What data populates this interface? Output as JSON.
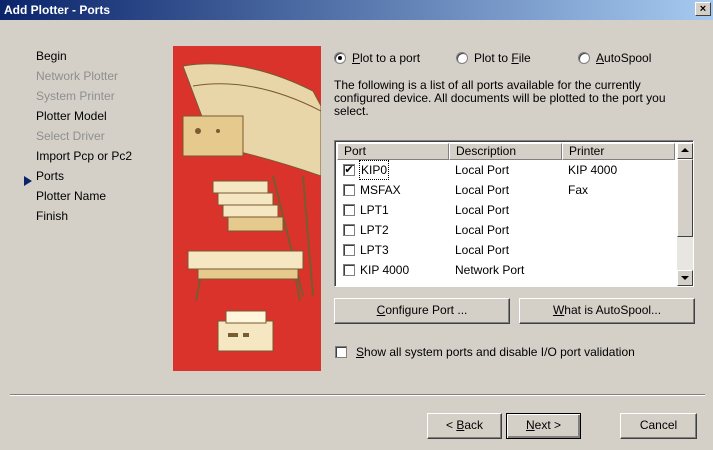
{
  "window": {
    "title": "Add Plotter - Ports",
    "close_glyph": "×"
  },
  "steps": [
    {
      "label": "Begin",
      "state": "normal"
    },
    {
      "label": "Network Plotter",
      "state": "disabled"
    },
    {
      "label": "System Printer",
      "state": "disabled"
    },
    {
      "label": "Plotter Model",
      "state": "normal"
    },
    {
      "label": "Select Driver",
      "state": "disabled"
    },
    {
      "label": "Import Pcp or Pc2",
      "state": "normal"
    },
    {
      "label": "Ports",
      "state": "current"
    },
    {
      "label": "Plotter Name",
      "state": "normal"
    },
    {
      "label": "Finish",
      "state": "normal"
    }
  ],
  "output_options": {
    "plot_to_port": {
      "pre": "",
      "key": "P",
      "post": "lot to a port",
      "selected": true
    },
    "plot_to_file": {
      "pre": "Plot to ",
      "key": "F",
      "post": "ile",
      "selected": false
    },
    "autospool": {
      "pre": "",
      "key": "A",
      "post": "utoSpool",
      "selected": false
    }
  },
  "description": "The following is a list of all ports available for the currently configured device. All documents will be plotted to the port you select.",
  "ports_table": {
    "columns": [
      "Port",
      "Description",
      "Printer"
    ],
    "rows": [
      {
        "port": "KIP0",
        "description": "Local Port",
        "printer": "KIP 4000",
        "checked": true
      },
      {
        "port": "MSFAX",
        "description": "Local Port",
        "printer": "Fax",
        "checked": false
      },
      {
        "port": "LPT1",
        "description": "Local Port",
        "printer": "",
        "checked": false
      },
      {
        "port": "LPT2",
        "description": "Local Port",
        "printer": "",
        "checked": false
      },
      {
        "port": "LPT3",
        "description": "Local Port",
        "printer": "",
        "checked": false
      },
      {
        "port": "KIP 4000",
        "description": "Network Port",
        "printer": "",
        "checked": false
      }
    ]
  },
  "buttons": {
    "configure_port": {
      "pre": "",
      "key": "C",
      "post": "onfigure Port ..."
    },
    "what_is_autospool": {
      "pre": "",
      "key": "W",
      "post": "hat is AutoSpool..."
    },
    "back": {
      "pre": "< ",
      "key": "B",
      "post": "ack"
    },
    "next": {
      "pre": "",
      "key": "N",
      "post": "ext >"
    },
    "cancel": {
      "label": "Cancel"
    }
  },
  "show_system_ports": {
    "pre": "",
    "key": "S",
    "post": "how all system ports and disable I/O port validation",
    "checked": false
  },
  "colors": {
    "accent": "#0a246a",
    "art_background": "#d9332b",
    "dialog": "#d4d0c8"
  }
}
